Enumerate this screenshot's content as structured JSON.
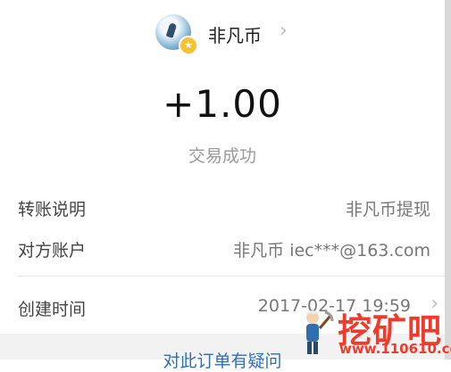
{
  "header": {
    "name": "非凡币",
    "avatar_icon": "user-avatar",
    "badge_icon": "star-icon",
    "badge_glyph": "★",
    "chevron_icon": "chevron-right-icon",
    "chevron_glyph": "›"
  },
  "amount": "+1.00",
  "status": "交易成功",
  "details": [
    {
      "label": "转账说明",
      "value": "非凡币提现"
    },
    {
      "label": "对方账户",
      "value": "非凡币 iec***@163.com"
    },
    {
      "label": "创建时间",
      "value": "2017-02-17 19:59"
    }
  ],
  "footer": {
    "link_text": "对此订单有疑问"
  },
  "watermark": {
    "text": "挖矿吧",
    "url": "www.110610.com"
  },
  "colors": {
    "link": "#2f6fb0",
    "badge": "#f6c233",
    "watermark": "#ee3b2b"
  }
}
